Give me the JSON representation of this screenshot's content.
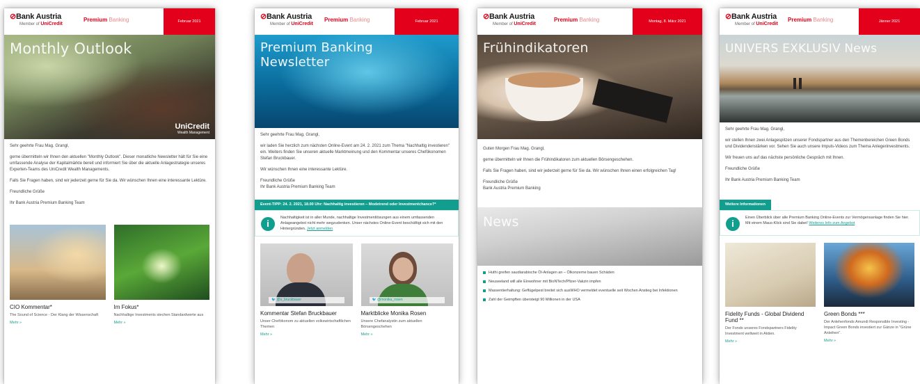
{
  "bank": "Bank Austria",
  "member_of": "Member of",
  "unicredit": "UniCredit",
  "premium": "Premium",
  "banking": "Banking",
  "cards": [
    {
      "date": "Februar 2021",
      "hero_title": "Monthly Outlook",
      "hero_badge": "UniCredit",
      "hero_badge_sub": "Wealth Management",
      "salutation": "Sehr geehrte Frau Mag. Grangl,",
      "para1": "gerne übermitteln wir Ihnen den aktuellen \"Monthly Outlook\". Dieser monatliche Newsletter hält für Sie eine umfassende Analyse der Kapitalmärkte bereit und informiert Sie über die aktuelle Anlagestrategie unseres Experten-Teams des UniCredit Wealth Managements.",
      "para2": "Falls Sie Fragen haben, sind wir jederzeit gerne für Sie da. Wir wünschen Ihnen eine interessante Lektüre.",
      "closing": "Freundliche Grüße",
      "team": "Ihr Bank Austria Premium Banking Team",
      "tiles": [
        {
          "title": "CIO Kommentar*",
          "desc": "The Sound of Science - Der Klang der Wissenschaft",
          "more": "Mehr »"
        },
        {
          "title": "Im Fokus*",
          "desc": "Nachhaltige Investments stechen Standardwerte aus",
          "more": "Mehr »"
        }
      ]
    },
    {
      "date": "Februar 2021",
      "hero_title": "Premium Banking\nNewsletter",
      "salutation": "Sehr geehrte Frau Mag. Grangl,",
      "para1": "wir laden Sie herzlich zum nächsten Online-Event am 24. 2. 2021 zum Thema \"Nachhaltig investieren\" ein. Weiters finden Sie unseren aktuelle Marktmeinung und den Kommentar unseres Chefökonomen Stefan Bruckbauer.",
      "para2": "Wir wünschen Ihnen eine interessante Lektüre.",
      "closing": "Freundliche Grüße\nIhr Bank Austria Premium Banking Team",
      "event_bar": "Event-TIPP: 24. 2. 2021, 18.00 Uhr: Nachhaltig investieren – Modetrend oder Investmentchance?*",
      "info_text": "Nachhaltigkeit ist in aller Munde, nachhaltige Investmentlösungen aus einem umfassenden Anlageangebot nicht mehr wegzudenken. Unser nächstes Online-Event beschäftigt sich mit den Hintergründen.",
      "info_link": "Jetzt anmelden",
      "people": [
        {
          "tag": "@s_bruckbauer",
          "name": "Kommentar Stefan Bruckbauer",
          "desc": "Unser Chefökonom zu aktuellen volkswirtschaftlichen Themen",
          "more": "Mehr »"
        },
        {
          "tag": "@monika_rosen",
          "name": "Marktblicke Monika Rosen",
          "desc": "Unsere Chefanalystin zum aktuellen Börsengeschehen",
          "more": "Mehr »"
        }
      ]
    },
    {
      "date": "Montag, 8. März 2021",
      "hero_title": "Frühindikatoren",
      "greeting": "Guten Morgen Frau Mag. Grangl,",
      "para1": "gerne übermitteln wir Ihnen die Frühindikatoren zum aktuellen Börsengeschehen.",
      "para2": "Falls Sie Fragen haben, sind wir jederzeit gerne für Sie da. Wir wünschen Ihnen einen erfolgreichen Tag!",
      "closing": "Freundliche Grüße\nBank Austria Premium Banking",
      "news_title": "News",
      "bullets": [
        "Huthi greifen saudiarabische Öl-Anlagen an – Ölkonzerne bauen Schäden",
        "Neuseeland will alle Einwohner mit BioNTech/Pfizer-Vakzin impfen",
        "Massentierhaltung: Geflügelpest breitet sich ausWHO vermeldet eventuelle seit Wochen Anstieg bei Infektionen",
        "Zahl der Geimpften übersteigt 90 Millionen in der USA"
      ]
    },
    {
      "date": "Jänner 2021",
      "hero_title": "UNIVERS EXKLUSIV News",
      "salutation": "Sehr geehrte Frau Mag. Grangl,",
      "para1": "wir stellen Ihnen zwei Anlagespitzen unserer Fondspartner aus den Themenbereichen Green Bonds und Dividendenstärken vor. Sehen Sie auch unsere Impuls-Videos zum Thema Anlegerinvestments.",
      "para2": "Wir freuen uns auf das nächste persönliche Gespräch mit Ihnen.",
      "closing": "Freundliche Grüße",
      "team": "Ihr Bank Austria Premium Banking Team",
      "teal_bar": "Weitere Informationen",
      "info_text": "Einen Überblick über alle Premium Banking Online-Events zur Vermögensanlage finden Sie hier. Mit einem Maus-Klick sind Sie dabei!",
      "info_link": "Weiteres Info zum Angebot",
      "tiles": [
        {
          "title": "Fidelity Funds - Global Dividend Fund **",
          "desc": "Der Fonds unseres Fondspartners Fidelity Investment weltweit in Aktien.",
          "more": "Mehr »"
        },
        {
          "title": "Green Bonds ***",
          "desc": "Der Anlehenfonds Amundi Responsible Investing - Impact Green Bonds investiert zur Gänze in \"Grüne Anleihen\".",
          "more": "Mehr »"
        }
      ]
    }
  ]
}
